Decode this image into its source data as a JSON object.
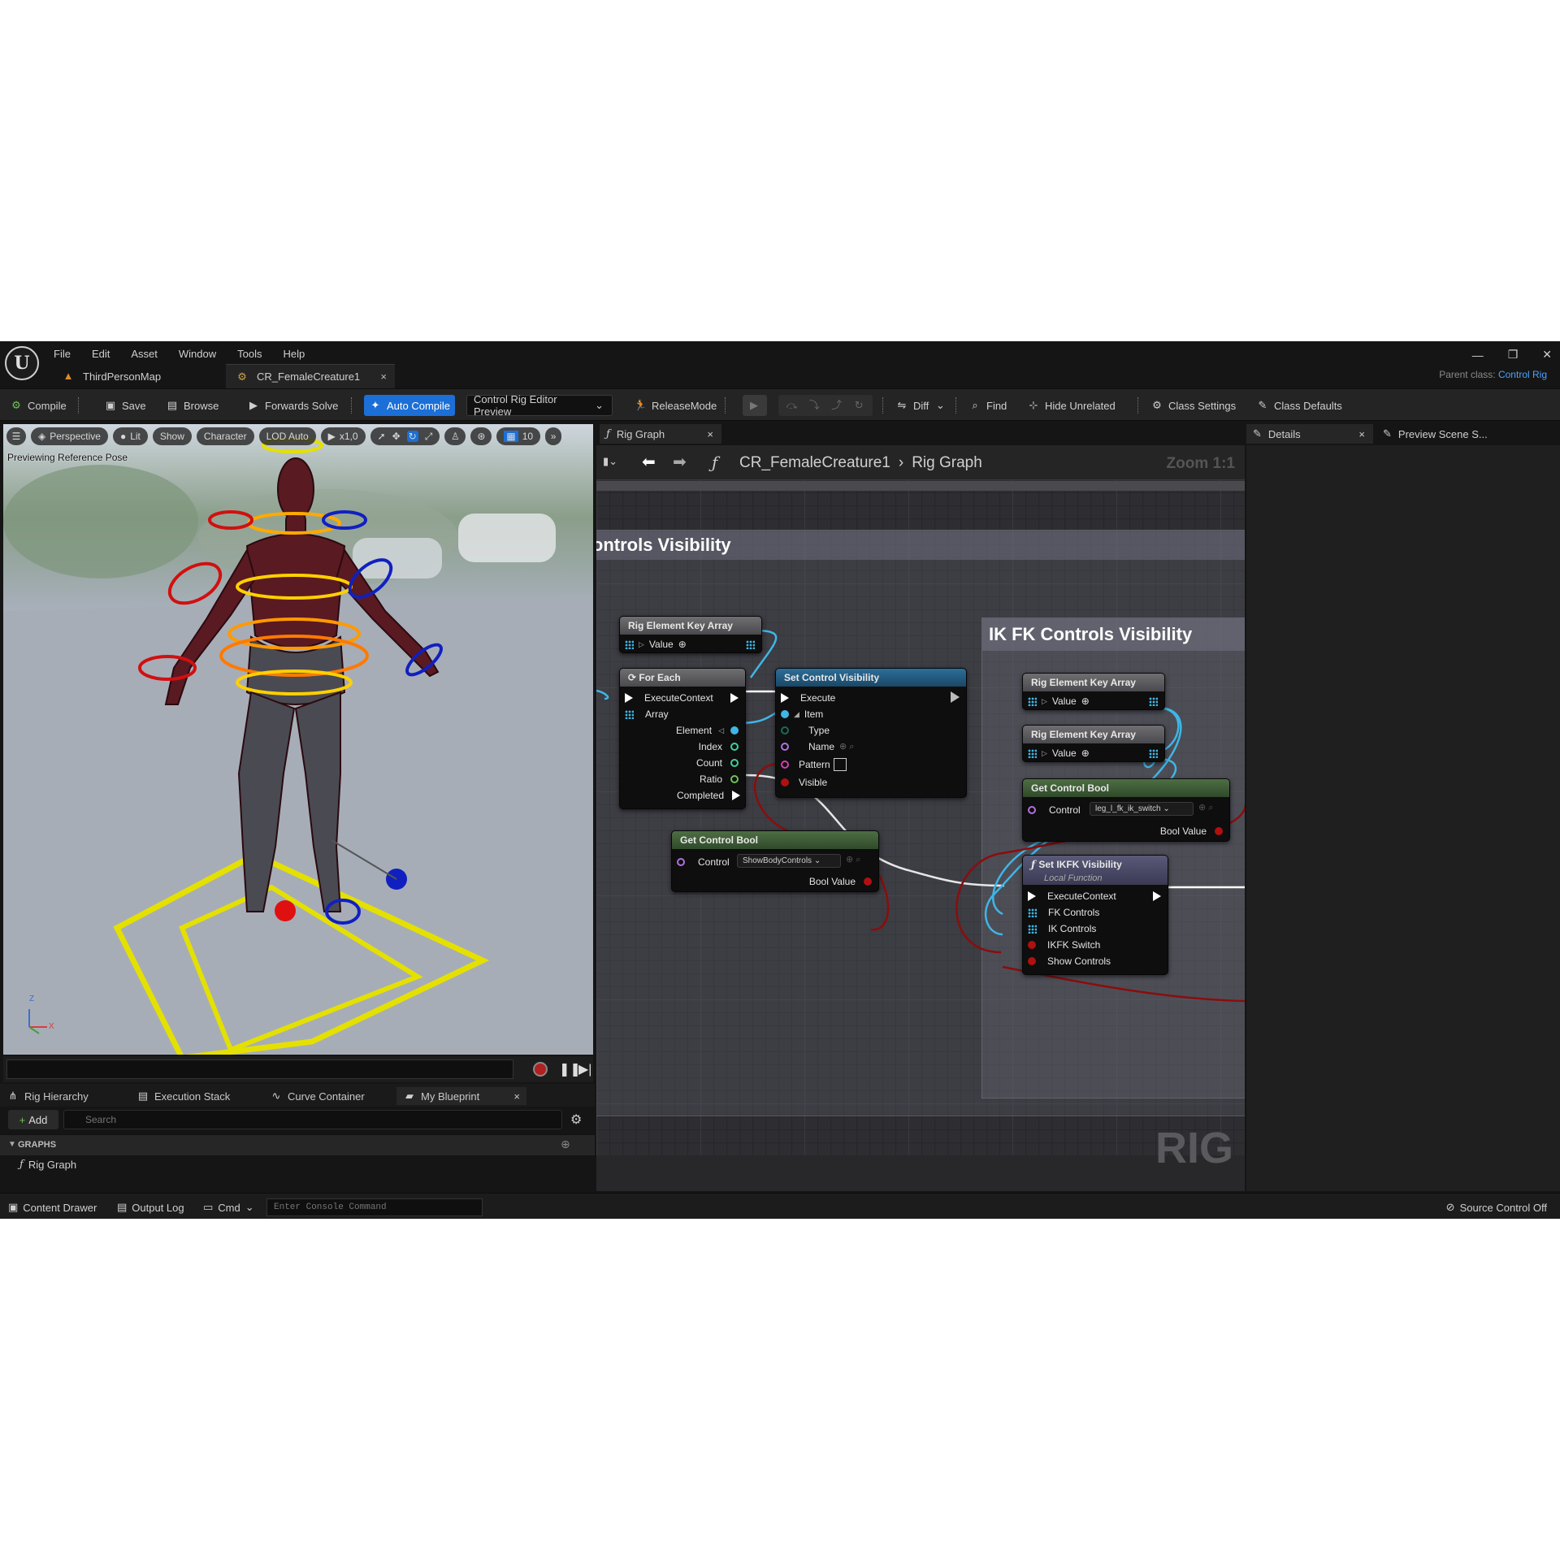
{
  "menu": [
    "File",
    "Edit",
    "Asset",
    "Window",
    "Tools",
    "Help"
  ],
  "tabs": {
    "map": "ThirdPersonMap",
    "asset": "CR_FemaleCreature1",
    "close": "×"
  },
  "window_controls": [
    "—",
    "❐",
    "✕"
  ],
  "parent_class": {
    "label": "Parent class:",
    "value": "Control Rig"
  },
  "toolbar": {
    "compile": "Compile",
    "save": "Save",
    "browse": "Browse",
    "forwards_solve": "Forwards Solve",
    "auto_compile": "Auto Compile",
    "preview": "Control Rig Editor Preview",
    "release_mode": "ReleaseMode",
    "diff": "Diff",
    "find": "Find",
    "hide_unrelated": "Hide Unrelated",
    "class_settings": "Class Settings",
    "class_defaults": "Class Defaults"
  },
  "viewport": {
    "perspective": "Perspective",
    "lit": "Lit",
    "show": "Show",
    "character": "Character",
    "lod": "LOD Auto",
    "speed": "x1,0",
    "grid_size": "10",
    "label": "Previewing Reference Pose",
    "axis_z": "Z",
    "axis_x": "X"
  },
  "left_panel": {
    "tabs": [
      "Rig Hierarchy",
      "Execution Stack",
      "Curve Container",
      "My Blueprint"
    ],
    "add": "Add",
    "search_placeholder": "Search",
    "graphs_header": "GRAPHS",
    "graph_item": "Rig Graph"
  },
  "graph": {
    "tab": "Rig Graph",
    "breadcrumb_asset": "CR_FemaleCreature1",
    "breadcrumb_graph": "Rig Graph",
    "zoom": "Zoom 1:1",
    "comment1": "Controls Visibility",
    "comment2": "IK FK Controls Visibility",
    "watermark": "RIG",
    "nodes": {
      "rek1": {
        "title": "Rig Element Key Array",
        "pin": "Value"
      },
      "foreach": {
        "title": "For Each",
        "pins": [
          "ExecuteContext",
          "Array",
          "Element",
          "Index",
          "Count",
          "Ratio",
          "Completed"
        ]
      },
      "setvis": {
        "title": "Set Control Visibility",
        "pins": [
          "Execute",
          "Item",
          "Type",
          "Name",
          "Pattern",
          "Visible"
        ]
      },
      "getbool1": {
        "title": "Get Control Bool",
        "control_label": "Control",
        "control_value": "ShowBodyControls",
        "out": "Bool Value"
      },
      "rek2": {
        "title": "Rig Element Key Array",
        "pin": "Value"
      },
      "rek3": {
        "title": "Rig Element Key Array",
        "pin": "Value"
      },
      "getbool2": {
        "title": "Get Control Bool",
        "control_label": "Control",
        "control_value": "leg_l_fk_ik_switch",
        "out": "Bool Value"
      },
      "setikfk": {
        "title": "Set IKFK Visibility",
        "subtitle": "Local Function",
        "pins": [
          "ExecuteContext",
          "FK Controls",
          "IK Controls",
          "IKFK Switch",
          "Show Controls"
        ]
      }
    }
  },
  "details": {
    "tab1": "Details",
    "tab2": "Preview Scene S..."
  },
  "statusbar": {
    "content_drawer": "Content Drawer",
    "output_log": "Output Log",
    "cmd": "Cmd",
    "console_placeholder": "Enter Console Command",
    "source_control": "Source Control Off"
  },
  "colors": {
    "accent": "#1b6fd6",
    "exec": "#ffffff",
    "struct": "#3fb6e6",
    "bool": "#b01010",
    "name": "#b070e0"
  }
}
